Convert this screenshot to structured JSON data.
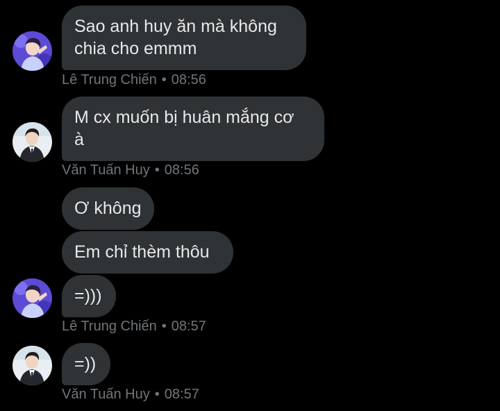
{
  "messages": [
    {
      "sender": "Lê Trung Chiến",
      "time": "08:56",
      "bubbles": [
        {
          "lines": [
            "Sao anh huy ăn mà không",
            "chia cho emmm"
          ]
        }
      ]
    },
    {
      "sender": "Văn Tuấn Huy",
      "time": "08:56",
      "bubbles": [
        {
          "lines": [
            "M cx muốn bị huân mắng cơ",
            "à"
          ]
        }
      ]
    },
    {
      "sender": "Lê Trung Chiến",
      "time": "08:57",
      "bubbles": [
        {
          "lines": [
            "Ơ không"
          ]
        },
        {
          "lines": [
            "Em chỉ thèm thôu"
          ]
        },
        {
          "lines": [
            "=)))"
          ]
        }
      ]
    },
    {
      "sender": "Văn Tuấn Huy",
      "time": "08:57",
      "bubbles": [
        {
          "lines": [
            "=))"
          ]
        }
      ]
    }
  ],
  "separator": "•",
  "colors": {
    "background": "#000000",
    "bubble": "#2f3336",
    "bubble_text": "#e7e9ea",
    "meta_text": "#71767b",
    "avatar_chien_bg": "#5b4bd6",
    "avatar_huy_bg": "#e8eef2"
  },
  "icons": {
    "avatar_chien": "avatar-chien-photo-icon",
    "avatar_huy": "avatar-huy-photo-icon"
  }
}
